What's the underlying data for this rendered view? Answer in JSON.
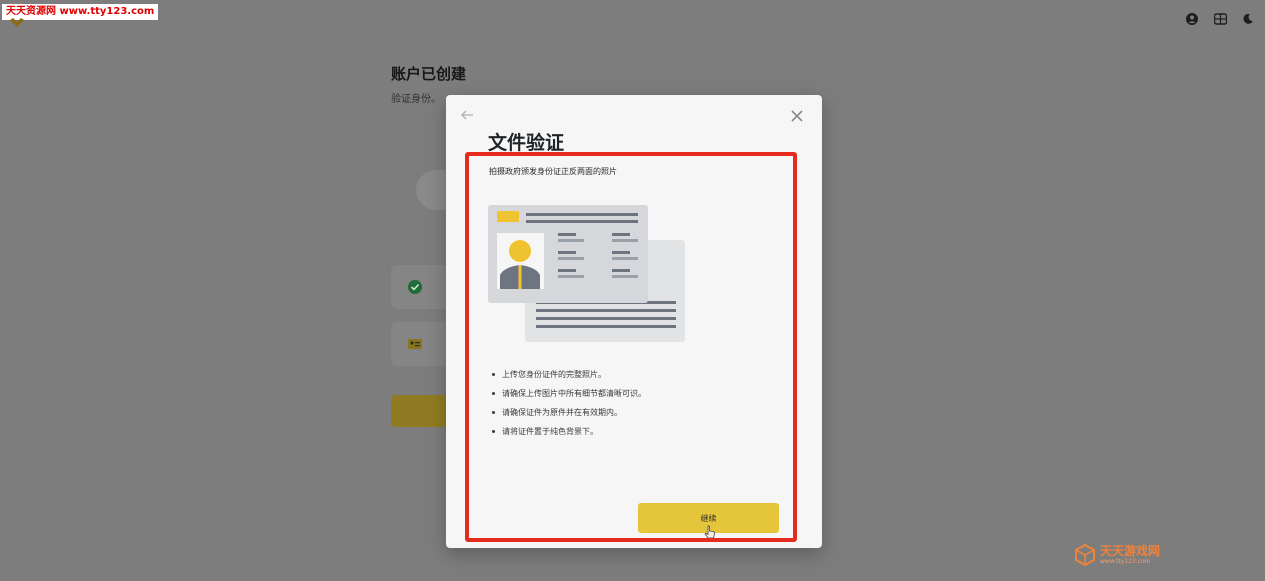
{
  "watermark_top": "天天资源网 www.tty123.com",
  "header_icons": [
    "account-icon",
    "globe-icon",
    "moon-icon"
  ],
  "background_page": {
    "title": "账户已创建",
    "subtitle": "验证身份。"
  },
  "modal": {
    "title": "文件验证",
    "description": "拍摄政府颁发身份证正反两面的照片",
    "tips": [
      "上传您身份证件的完整照片。",
      "请确保上传图片中所有细节都清晰可识。",
      "请确保证件为原件并在有效期内。",
      "请将证件置于纯色背景下。"
    ],
    "continue_label": "继续"
  },
  "watermark_bottom": {
    "name": "天天游戏网",
    "url": "www.tty123.com"
  },
  "colors": {
    "accent": "#e5c53a",
    "highlight": "#e52b1e",
    "overlay": "#7d7d7d"
  }
}
